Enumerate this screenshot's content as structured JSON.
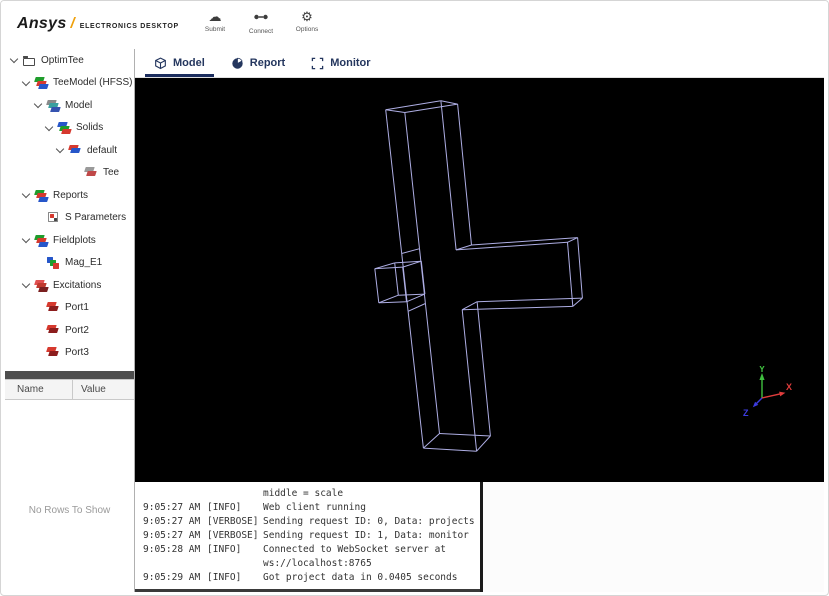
{
  "header": {
    "brand": "Ansys",
    "brand_slash": "/",
    "brand_product": "ELECTRONICS DESKTOP",
    "toolbar": [
      {
        "label": "Submit",
        "icon": "cloud-icon"
      },
      {
        "label": "Connect",
        "icon": "connect-icon"
      },
      {
        "label": "Options",
        "icon": "gear-icon"
      }
    ]
  },
  "tabs": [
    {
      "label": "Model",
      "active": true
    },
    {
      "label": "Report",
      "active": false
    },
    {
      "label": "Monitor",
      "active": false
    }
  ],
  "tree": [
    {
      "label": "OptimTee",
      "icon": "folder-icon"
    },
    {
      "label": "TeeModel (HFSS)",
      "icon": "hfss-design-icon"
    },
    {
      "label": "Model",
      "icon": "model-icon"
    },
    {
      "label": "Solids",
      "icon": "solids-icon"
    },
    {
      "label": "default",
      "icon": "material-icon"
    },
    {
      "label": "Tee",
      "icon": "solid-tee-icon"
    },
    {
      "label": "Reports",
      "icon": "reports-icon"
    },
    {
      "label": "S Parameters",
      "icon": "s-parameters-icon"
    },
    {
      "label": "Fieldplots",
      "icon": "fieldplots-icon"
    },
    {
      "label": "Mag_E1",
      "icon": "fieldplot-icon"
    },
    {
      "label": "Excitations",
      "icon": "excitations-icon"
    },
    {
      "label": "Port1",
      "icon": "port-icon"
    },
    {
      "label": "Port2",
      "icon": "port-icon"
    },
    {
      "label": "Port3",
      "icon": "port-icon"
    }
  ],
  "properties": {
    "columns": [
      "Name",
      "Value"
    ],
    "empty": "No Rows To Show"
  },
  "viewport": {
    "background": "#000000",
    "wireframe_color": "#aeaee4",
    "axes": {
      "x": "X",
      "y": "Y",
      "z": "Z"
    },
    "axis_colors": {
      "x": "#e03c3c",
      "y": "#3fbf3f",
      "z": "#3c3ce0"
    }
  },
  "console": {
    "lines": [
      {
        "time": "",
        "level": "",
        "message": "middle = scale"
      },
      {
        "time": "9:05:27 AM",
        "level": "[INFO]",
        "message": "Web client running"
      },
      {
        "time": "9:05:27 AM",
        "level": "[VERBOSE]",
        "message": "Sending request ID: 0, Data: projects"
      },
      {
        "time": "9:05:27 AM",
        "level": "[VERBOSE]",
        "message": "Sending request ID: 1, Data: monitor"
      },
      {
        "time": "9:05:28 AM",
        "level": "[INFO]",
        "message": "Connected to WebSocket server at"
      },
      {
        "time": "",
        "level": "",
        "message": "ws://localhost:8765"
      },
      {
        "time": "9:05:29 AM",
        "level": "[INFO]",
        "message": "Got project data in 0.0405 seconds"
      }
    ]
  }
}
